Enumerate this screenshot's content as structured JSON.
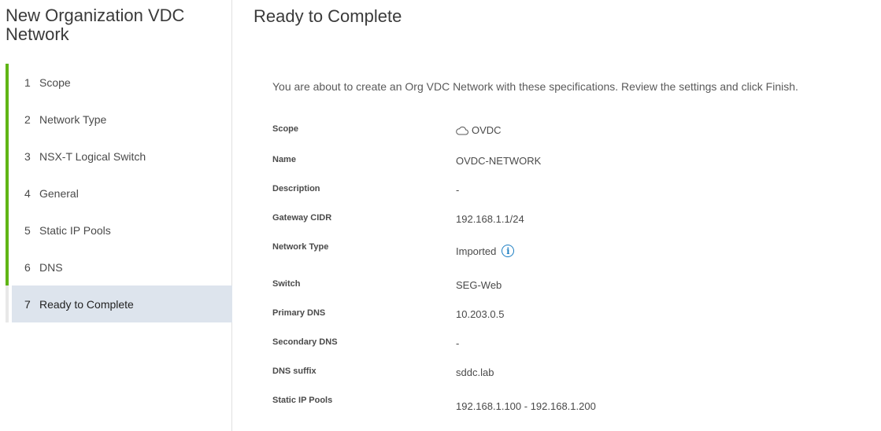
{
  "wizard": {
    "title": "New Organization VDC Network",
    "steps": [
      {
        "number": "1",
        "label": "Scope"
      },
      {
        "number": "2",
        "label": "Network Type"
      },
      {
        "number": "3",
        "label": "NSX-T Logical Switch"
      },
      {
        "number": "4",
        "label": "General"
      },
      {
        "number": "5",
        "label": "Static IP Pools"
      },
      {
        "number": "6",
        "label": "DNS"
      },
      {
        "number": "7",
        "label": "Ready to Complete"
      }
    ],
    "current_step": 7,
    "colors": {
      "completed_bar": "#60b515",
      "current_highlight": "#dde4ed",
      "info_icon": "#1a7dc2"
    }
  },
  "main": {
    "title": "Ready to Complete",
    "intro": "You are about to create an Org VDC Network with these specifications. Review the settings and click Finish.",
    "fields": [
      {
        "key": "Scope",
        "value": "OVDC",
        "icon": "cloud-icon"
      },
      {
        "key": "Name",
        "value": "OVDC-NETWORK"
      },
      {
        "key": "Description",
        "value": "-"
      },
      {
        "key": "Gateway CIDR",
        "value": "192.168.1.1/24"
      },
      {
        "key": "Network Type",
        "value": "Imported",
        "icon": "info-icon"
      },
      {
        "key": "Switch",
        "value": "SEG-Web"
      },
      {
        "key": "Primary DNS",
        "value": "10.203.0.5"
      },
      {
        "key": "Secondary DNS",
        "value": "-"
      },
      {
        "key": "DNS suffix",
        "value": "sddc.lab"
      },
      {
        "key": "Static IP Pools",
        "value": "192.168.1.100 - 192.168.1.200"
      }
    ]
  }
}
